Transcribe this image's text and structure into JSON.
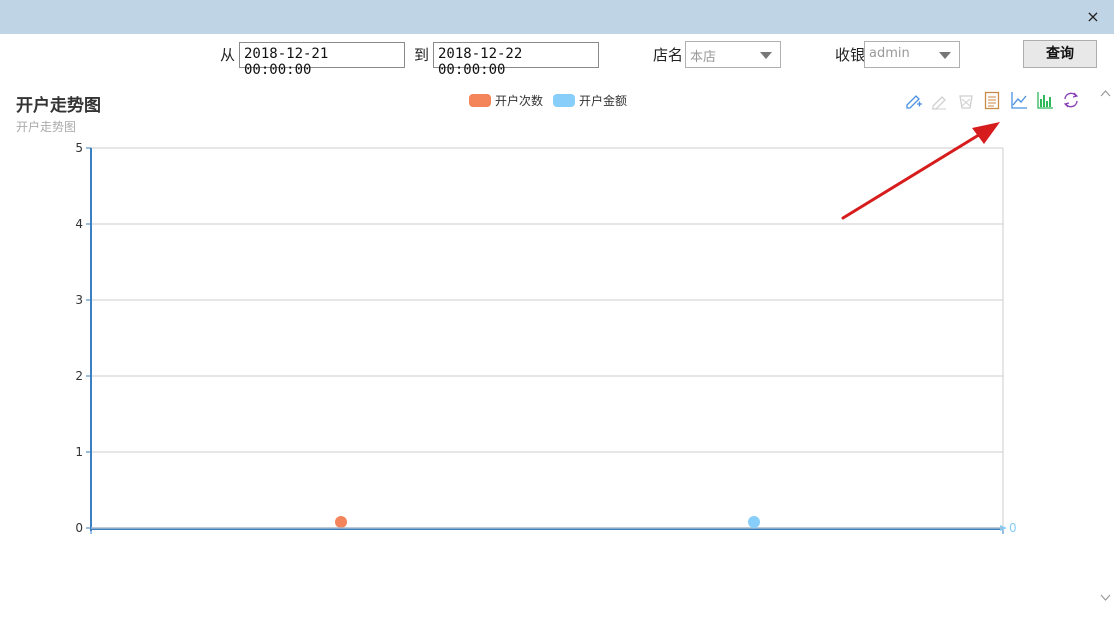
{
  "window": {
    "close_label": "×"
  },
  "filters": {
    "from_label": "从",
    "from_value": "2018-12-21 00:00:00",
    "to_label": "到",
    "to_value": "2018-12-22 00:00:00",
    "store_label": "店名",
    "store_value": "本店",
    "cashier_label": "收银",
    "cashier_value": "admin",
    "query_label": "查询"
  },
  "toolbox": {
    "icons": [
      "zoom-select-icon",
      "zoom-reset-icon",
      "restore-icon",
      "data-view-icon",
      "line-chart-icon",
      "bar-chart-icon",
      "refresh-icon"
    ]
  },
  "colors": {
    "series_count": "#f4845a",
    "series_amount": "#87cefa",
    "axis": "#3a7fc0",
    "grid": "#cccccc",
    "annotation_arrow": "#d61c1c"
  },
  "chart_data": {
    "type": "line",
    "title": "开户走势图",
    "subtitle": "开户走势图",
    "categories": [
      "",
      ""
    ],
    "series": [
      {
        "name": "开户次数",
        "values": [
          0
        ]
      },
      {
        "name": "开户金额",
        "values": [
          0
        ]
      }
    ],
    "y_ticks": [
      "0",
      "1",
      "2",
      "3",
      "4",
      "5"
    ],
    "y_right_tick": "0",
    "ylim": [
      0,
      5
    ],
    "grid": true,
    "legend_position": "top-center"
  }
}
